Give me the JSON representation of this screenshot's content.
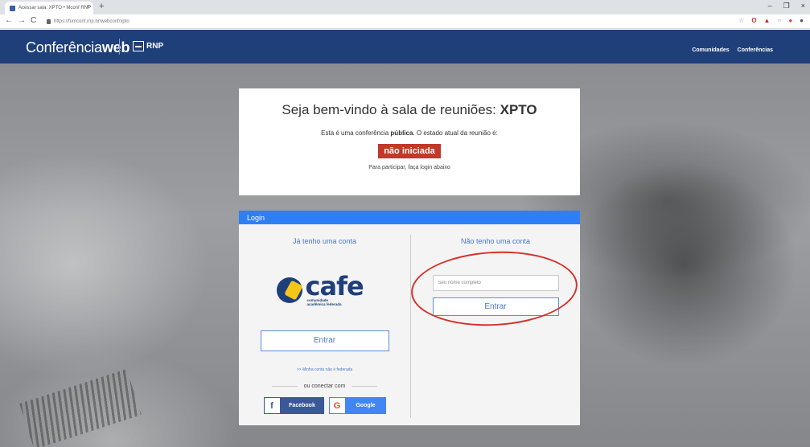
{
  "browser": {
    "tab_title": "Acessar sala: XPTO • Mconf RNP",
    "tab_close": "×",
    "new_tab": "+",
    "url": "https://fumconf.rnp.br/webconf/xpto",
    "window_controls": [
      "–",
      "❐",
      "×"
    ]
  },
  "header": {
    "brand_light": "Conferência",
    "brand_bold": "web",
    "partner": "RNP",
    "nav": [
      "Comunidades",
      "Conferências"
    ]
  },
  "welcome": {
    "title_prefix": "Seja bem-vindo à sala de reuniões: ",
    "room_name": "XPTO",
    "line_prefix": "Esta é uma conferência ",
    "conference_type": "pública",
    "line_suffix": ". O estado atual da reunião é:",
    "status": "não iniciada",
    "status_color": "#c0392b",
    "hint": "Para participar, faça login abaixo"
  },
  "login": {
    "header": "Login",
    "left": {
      "title": "Já tenho uma conta",
      "cafe_word": "cafe",
      "cafe_sub_1": "comunidade",
      "cafe_sub_2": "acadêmica federada",
      "enter_label": "Entrar",
      "non_federated_link": ">> Minha conta não é federada",
      "or_text": "ou conectar com",
      "facebook_label": "Facebook",
      "google_label": "Google"
    },
    "right": {
      "title": "Não tenho uma conta",
      "name_placeholder": "Seu nome completo",
      "name_value": "",
      "enter_label": "Entrar"
    }
  },
  "colors": {
    "header_bg": "#1f3f7a",
    "login_header_bg": "#2e7ff5",
    "annotation": "#d6322a"
  }
}
